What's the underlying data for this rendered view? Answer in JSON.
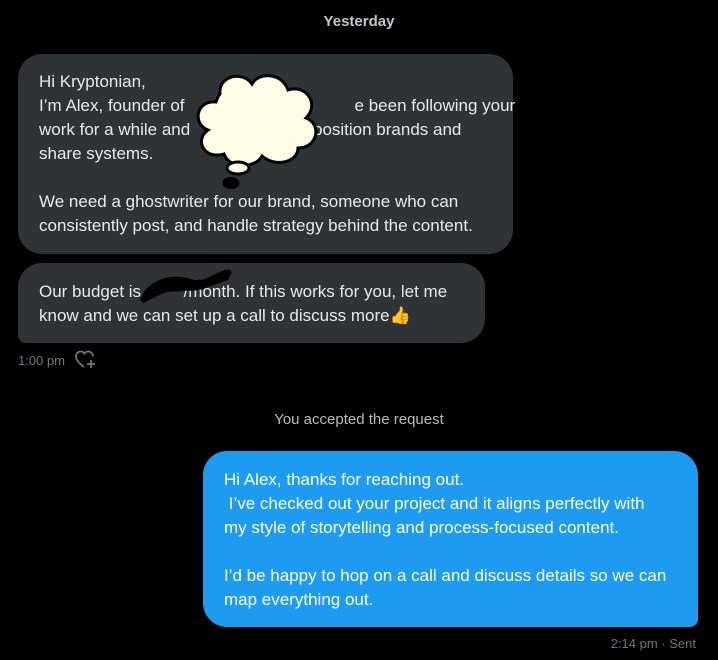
{
  "conversation": {
    "date_separator": "Yesterday",
    "incoming": {
      "message1_lines": [
        "Hi Kryptonian,",
        "I’m Alex, founder of                                    e been following your",
        "work for a while and                          position brands and",
        "share systems.",
        "",
        "We need a ghostwriter for our brand, someone who can",
        "consistently post, and handle strategy behind the content."
      ],
      "message2_lines": [
        "Our budget is         /month. If this works for you, let me",
        "know and we can set up a call to discuss more👍"
      ],
      "time": "1:00 pm",
      "react_icon": "heart-plus-icon"
    },
    "system_message": "You accepted the request",
    "outgoing": {
      "message_lines": [
        "Hi Alex, thanks for reaching out.",
        " I’ve checked out your project and it aligns perfectly with",
        "my style of storytelling and process-focused content.",
        "",
        "I’d be happy to hop on a call and discuss details so we can",
        "map everything out."
      ],
      "status": "2:14 pm · Sent"
    }
  },
  "colors": {
    "background": "#000000",
    "incoming_bubble": "#2f3336",
    "outgoing_bubble": "#1d9bf0",
    "meta_text": "#71767b",
    "censor_cloud": "#fffde6"
  }
}
